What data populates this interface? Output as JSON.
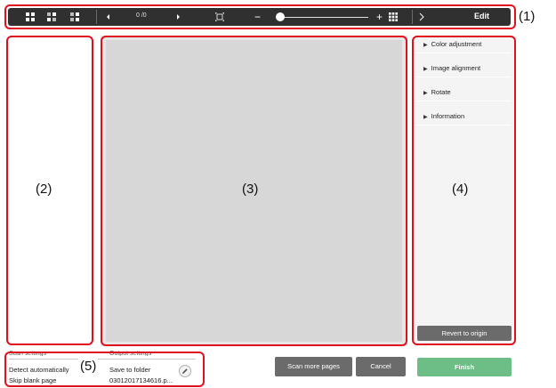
{
  "toolbar": {
    "page_indicator": "0 /0",
    "edit_label": "Edit"
  },
  "callouts": {
    "toolbar": "(1)",
    "thumbnail_panel": "(2)",
    "preview": "(3)",
    "edit_panel": "(4)",
    "scan_info": "(5)"
  },
  "edit_panel": {
    "items": [
      {
        "label": "Color adjustment"
      },
      {
        "label": "Image alignment"
      },
      {
        "label": "Rotate"
      },
      {
        "label": "Information"
      }
    ],
    "revert_label": "Revert to origin"
  },
  "scan_settings": {
    "header": "Scan settings",
    "line1": "Detect automatically",
    "line2": "Skip blank page"
  },
  "output_settings": {
    "header": "Output settings",
    "line1": "Save to folder",
    "line2": "03012017134616.p..."
  },
  "buttons": {
    "scan_more": "Scan more pages",
    "cancel": "Cancel",
    "finish": "Finish"
  },
  "icons": {
    "view_large": "grid-large-icon",
    "view_medium": "grid-medium-icon",
    "view_small": "grid-small-icon",
    "prev": "chevron-left-icon",
    "next": "chevron-right-icon",
    "fit": "fit-page-icon",
    "zoom_out": "minus-icon",
    "zoom_in": "plus-icon",
    "thumbnail_grid": "thumbnail-grid-icon",
    "expand": "chevron-right-icon",
    "pencil": "pencil-icon"
  },
  "colors": {
    "callout": "#e0101e",
    "toolbar_bg": "#303030",
    "finish": "#6cbd86",
    "gray_button": "#6b6b6b"
  }
}
